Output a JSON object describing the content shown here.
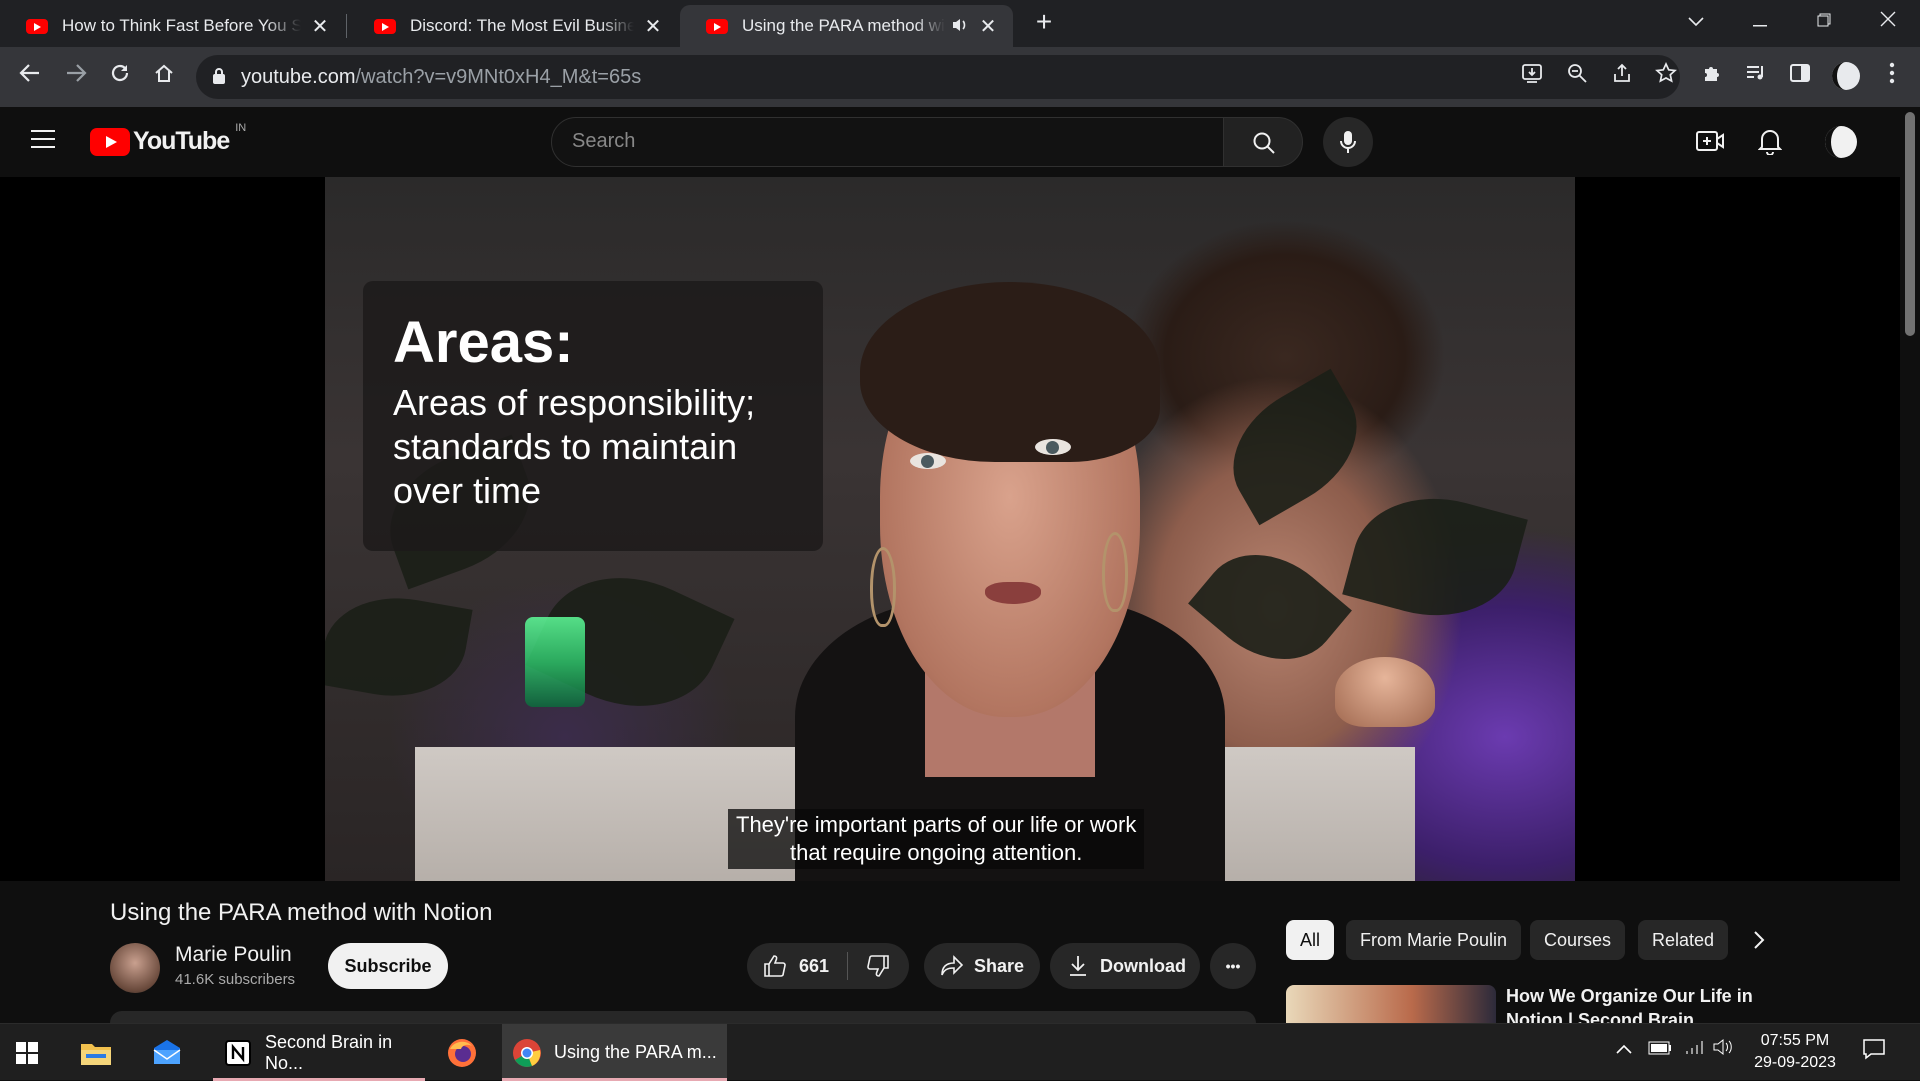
{
  "browser": {
    "tabs": [
      {
        "title": "How to Think Fast Before You Speak",
        "active": false
      },
      {
        "title": "Discord: The Most Evil Business Model",
        "active": false
      },
      {
        "title": "Using the PARA method with Notion",
        "active": true,
        "audio": true
      }
    ],
    "new_tab_label": "+",
    "url_host": "youtube.com",
    "url_path": "/watch?v=v9MNt0xH4_M&t=65s"
  },
  "youtube": {
    "logo_text": "YouTube",
    "country": "IN",
    "search_placeholder": "Search"
  },
  "video": {
    "overlay_heading": "Areas:",
    "overlay_body_lines": [
      "Areas of responsibility;",
      "standards to maintain",
      "over time"
    ],
    "caption_lines": [
      "They're important parts of our life or work",
      "that require ongoing attention."
    ]
  },
  "details": {
    "title": "Using the PARA method with Notion",
    "channel": "Marie Poulin",
    "subscribers": "41.6K subscribers",
    "subscribe_label": "Subscribe",
    "likes": "661",
    "share_label": "Share",
    "download_label": "Download",
    "more_label": "•••"
  },
  "sidebar": {
    "chips": [
      "All",
      "From Marie Poulin",
      "Courses",
      "Related"
    ],
    "selected_chip": "All",
    "reco_title": "How We Organize Our Life in Notion | Second Brain"
  },
  "taskbar": {
    "apps": [
      {
        "label": "Second Brain in No...",
        "icon": "notion-icon"
      },
      {
        "label": "Using the PARA m...",
        "icon": "chrome-icon"
      }
    ],
    "time": "07:55 PM",
    "date": "29-09-2023"
  },
  "colors": {
    "youtube_red": "#ff0000",
    "bg_dark": "#0f0f0f",
    "chrome_frame": "#202124",
    "toolbar": "#35363a"
  }
}
